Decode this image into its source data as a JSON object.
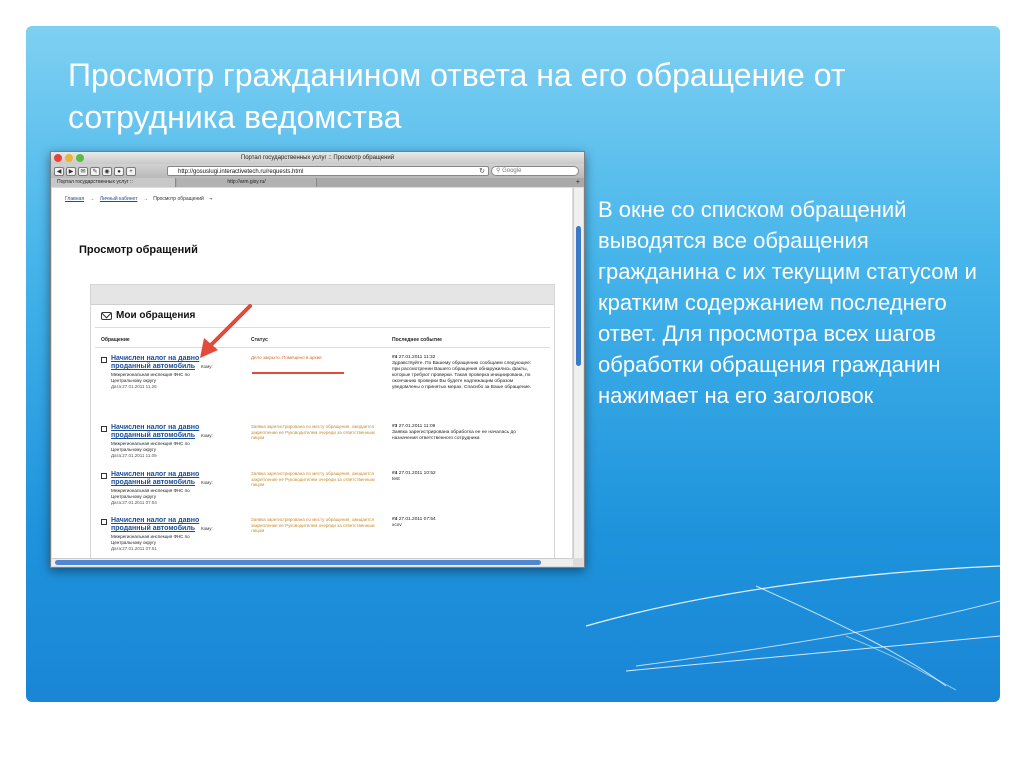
{
  "slide": {
    "title": "Просмотр гражданином ответа на его обращение от сотрудника ведомства",
    "description": "В окне со списком обращений выводятся все обращения гражданина с их текущим статусом и кратким содержанием последнего ответ. Для просмотра всех шагов обработки обращения гражданин нажимает на его заголовок"
  },
  "browser": {
    "window_title": "Портал государственных услуг :: Просмотр обращений",
    "url": "http://gosuslugi.interactivetech.ru/requests.html",
    "search_placeholder": "Google",
    "tabs": [
      {
        "label": "Портал государственных услуг ::"
      },
      {
        "label": "http://arm.gisy.ru/"
      }
    ]
  },
  "page": {
    "breadcrumb": {
      "home": "Главная",
      "cabinet": "Личный кабинет",
      "current": "Просмотр обращений"
    },
    "title": "Просмотр обращений",
    "panel_title": "Мои обращения",
    "columns": [
      "Обращение",
      "Статус",
      "Последнее событие"
    ],
    "requests": [
      {
        "title": "Начислен налог на давно проданный автомобиль",
        "to_label": "Кому:",
        "recipient": "Межрегиональная инспекция ФНС по Центральному округу",
        "date": "Дата:27.01.2011 11.26",
        "status": "Дело закрыто. Помещено в архив",
        "event_num": "#4",
        "event_date": "27.01.2011 11:32",
        "event_text": "Здравствуйте. По Вашему обращению сообщаем следующее: при рассмотрении Вашего обращения обнаружились факты, которые требуют проверки. Такая проверка инициирована, по окончанию проверки Вы будете надлежащим образом уведомлены о принятых мерах. Спасибо за Ваше обращение."
      },
      {
        "title": "Начислен налог на давно проданный автомобиль",
        "to_label": "Кому:",
        "recipient": "Межрегиональная инспекция ФНС по Центральному округу",
        "date": "Дата:27.01.2011 11.09",
        "status": "Заявка зарегистрирована по месту обращения, ожидается закрепление ее Руководителем очереди за ответственным лицом",
        "event_num": "#3",
        "event_date": "27.01.2011 11:09",
        "event_text": "Заявка зарегистрирована обработка ее не началась до назначения ответственного сотрудника"
      },
      {
        "title": "Начислен налог на давно проданный автомобиль",
        "to_label": "Кому:",
        "recipient": "Межрегиональная инспекция ФНС по Центральному округу",
        "date": "Дата:27.01.2011 07.54",
        "status": "Заявка зарегистрирована по месту обращения, ожидается закрепление ее Руководителем очереди за ответственным лицом",
        "event_num": "#4",
        "event_date": "27.01.2011 10:52",
        "event_text": "test"
      },
      {
        "title": "Начислен налог на давно проданный автомобиль",
        "to_label": "Кому:",
        "recipient": "Межрегиональная инспекция ФНС по Центральному округу",
        "date": "Дата:27.01.2011 07.51",
        "status": "Заявка зарегистрирована по месту обращения, ожидается закрепление ее Руководителем очереди за ответственным лицом",
        "event_num": "#4",
        "event_date": "27.01.2011 07:54",
        "event_text": "xcxv"
      }
    ]
  },
  "colors": {
    "slide_top": "#7ed0f2",
    "slide_bottom": "#1a86d6",
    "link": "#1a4e9c",
    "status_orange": "#c98a2b",
    "arrow_red": "#e24a3a"
  }
}
